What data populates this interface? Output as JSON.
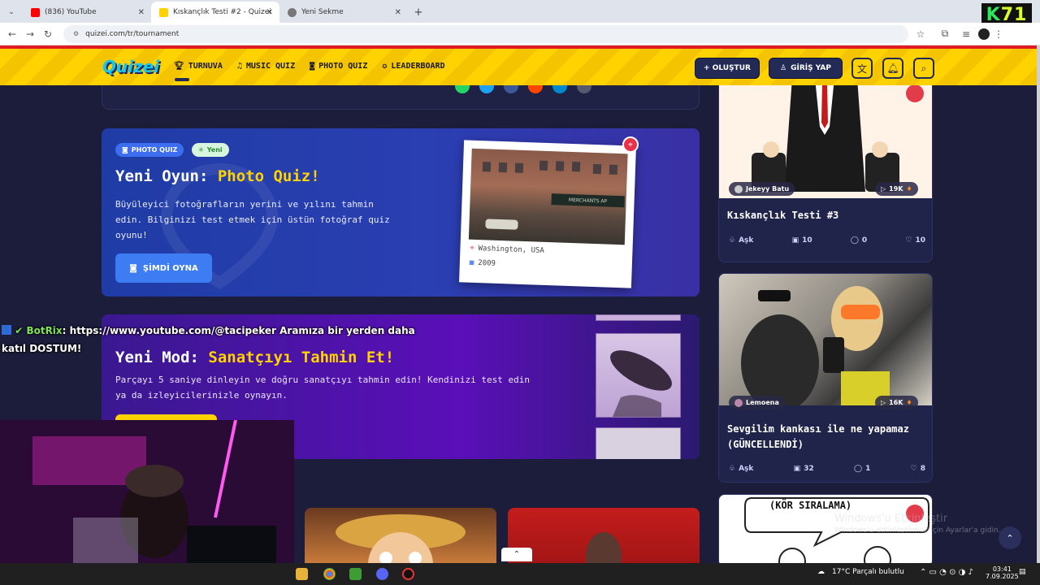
{
  "browser": {
    "tabs": [
      {
        "title": "(836) YouTube",
        "color": "#ff0000"
      },
      {
        "title": "Kıskançlık Testi #2 - Quizei",
        "color": "#ffd200"
      },
      {
        "title": "Yeni Sekme",
        "color": "#555555"
      }
    ],
    "url": "quizei.com/tr/tournament",
    "corner_badge_k": "K",
    "corner_badge_num": "71"
  },
  "site": {
    "logo": "Quizei",
    "nav": [
      {
        "label": "TURNUVA",
        "icon": "trophy-icon"
      },
      {
        "label": "MUSIC QUIZ",
        "icon": "music-icon"
      },
      {
        "label": "PHOTO QUIZ",
        "icon": "camera-icon"
      },
      {
        "label": "LEADERBOARD",
        "icon": "medal-icon"
      }
    ],
    "create_label": "+ OLUŞTUR",
    "login_label": "GİRİŞ YAP"
  },
  "photo_quiz": {
    "badge": "PHOTO QUIZ",
    "new_badge": "Yeni",
    "title_prefix": "Yeni Oyun:",
    "title_highlight": "Photo Quiz!",
    "description": "Büyüleyici fotoğrafların yerini ve yılını tahmin edin. Bilginizi test etmek için üstün fotoğraf quiz oyunu!",
    "button": "ŞİMDİ OYNA",
    "location": "Washington, USA",
    "year": "2009",
    "sign_text": "MERCHANTS AP"
  },
  "artist_mode": {
    "title_prefix": "Yeni Mod:",
    "title_highlight": "Sanatçıyı Tahmin Et!",
    "description": "Parçayı 5 saniye dinleyin ve doğru sanatçıyı tahmin edin! Kendinizi test edin ya da izleyicilerinizle oynayın."
  },
  "chat": {
    "user": "BotRix",
    "message_line1": ": https://www.youtube.com/@tacipeker Aramıza bir yerden daha",
    "message_line2": "katıl DOSTUM!"
  },
  "right_cards": [
    {
      "author": "Jekeyy Batu",
      "views": "19K",
      "title": "Kıskançlık Testi #3",
      "category": "Aşk",
      "questions": "10",
      "comments": "0",
      "likes": "10"
    },
    {
      "author": "Lemoena",
      "views": "16K",
      "title": "Sevgilim kankası ile ne yapamaz (GÜNCELLENDİ)",
      "category": "Aşk",
      "questions": "32",
      "comments": "1",
      "likes": "8"
    },
    {
      "banner": "(KÖR SIRALAMA)"
    }
  ],
  "windows": {
    "watermark_line1": "Windows'u Etkinleştir",
    "watermark_line2": "Windows'u etkinleştirmek için Ayarlar'a gidin.",
    "weather": "17°C  Parçalı bulutlu",
    "time": "03:41",
    "date": "7.09.2025"
  }
}
